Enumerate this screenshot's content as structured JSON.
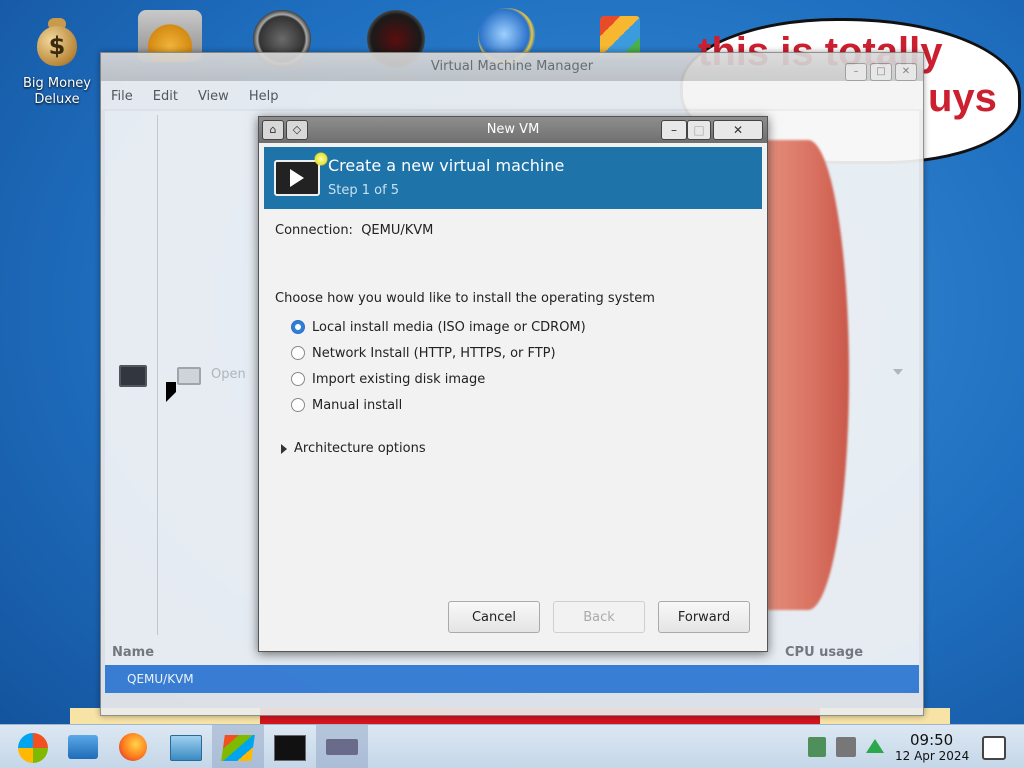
{
  "desktop": {
    "icons": [
      {
        "label": "Big Money Deluxe"
      }
    ],
    "bubble_text_1": "this is totally",
    "bubble_text_2": "uys"
  },
  "vmm": {
    "title": "Virtual Machine Manager",
    "menu": [
      "File",
      "Edit",
      "View",
      "Help"
    ],
    "toolbar_open": "Open",
    "col_name": "Name",
    "col_cpu": "CPU usage",
    "row_connection": "QEMU/KVM"
  },
  "dialog": {
    "title": "New VM",
    "banner_title": "Create a new virtual machine",
    "banner_step": "Step 1 of 5",
    "connection_label": "Connection:",
    "connection_value": "QEMU/KVM",
    "install_prompt": "Choose how you would like to install the operating system",
    "options": [
      {
        "label": "Local install media (ISO image or CDROM)",
        "selected": true
      },
      {
        "label": "Network Install (HTTP, HTTPS, or FTP)",
        "selected": false
      },
      {
        "label": "Import existing disk image",
        "selected": false
      },
      {
        "label": "Manual install",
        "selected": false
      }
    ],
    "arch_options": "Architecture options",
    "buttons": {
      "cancel": "Cancel",
      "back": "Back",
      "forward": "Forward"
    }
  },
  "taskbar": {
    "time": "09:50",
    "date": "12 Apr 2024"
  },
  "colors": {
    "accent": "#1e73a8",
    "selection": "#3b80d6"
  }
}
